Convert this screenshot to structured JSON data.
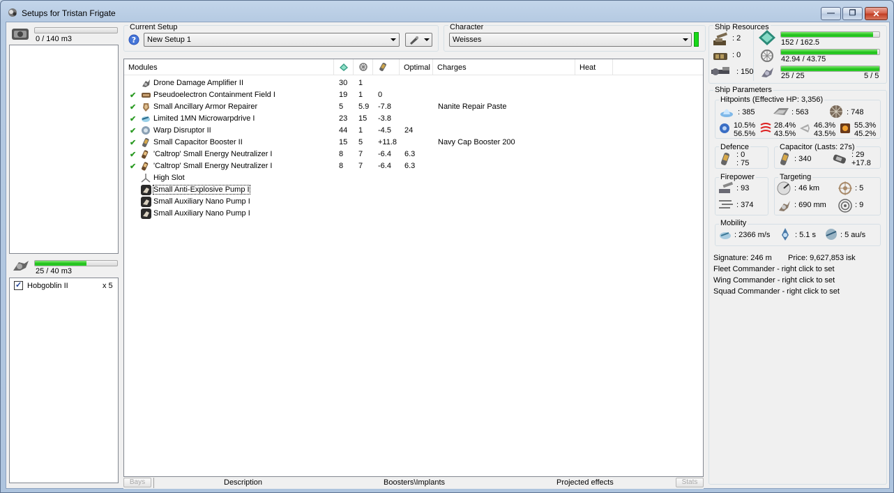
{
  "window": {
    "title": "Setups for Tristan Frigate"
  },
  "cargo": {
    "capacity": "0 / 140 m3",
    "fill": 0
  },
  "drone_bay": {
    "capacity": "25 / 40 m3",
    "fill": 0.625,
    "items": [
      {
        "name": "Hobgoblin II",
        "qty": "x 5",
        "checked": true
      }
    ]
  },
  "setup": {
    "label": "Current Setup",
    "value": "New Setup 1"
  },
  "character": {
    "label": "Character",
    "value": "Weisses"
  },
  "modules": {
    "columns": {
      "name": "Modules",
      "optimal": "Optimal",
      "charges": "Charges",
      "heat": "Heat"
    },
    "rows": [
      {
        "check": "",
        "name": "Drone Damage Amplifier II",
        "c1": "30",
        "c2": "1",
        "c3": "",
        "c4": "",
        "c5": "",
        "icon": "drone-damage-icon"
      },
      {
        "check": "✔",
        "name": "Pseudoelectron Containment Field I",
        "c1": "19",
        "c2": "1",
        "c3": "0",
        "c4": "",
        "c5": "",
        "icon": "containment-field-icon"
      },
      {
        "check": "✔",
        "name": "Small Ancillary Armor Repairer",
        "c1": "5",
        "c2": "5.9",
        "c3": "-7.8",
        "c4": "",
        "c5": "Nanite Repair Paste",
        "icon": "armor-repairer-icon"
      },
      {
        "check": "✔",
        "name": "Limited 1MN Microwarpdrive I",
        "c1": "23",
        "c2": "15",
        "c3": "-3.8",
        "c4": "",
        "c5": "",
        "icon": "microwarpdrive-icon"
      },
      {
        "check": "✔",
        "name": "Warp Disruptor II",
        "c1": "44",
        "c2": "1",
        "c3": "-4.5",
        "c4": "24",
        "c5": "",
        "icon": "warp-disruptor-icon"
      },
      {
        "check": "✔",
        "name": "Small Capacitor Booster II",
        "c1": "15",
        "c2": "5",
        "c3": "+11.8",
        "c4": "",
        "c5": "Navy Cap Booster 200",
        "icon": "capacitor-booster-icon"
      },
      {
        "check": "✔",
        "name": "'Caltrop' Small Energy Neutralizer I",
        "c1": "8",
        "c2": "7",
        "c3": "-6.4",
        "c4": "6.3",
        "c5": "",
        "icon": "energy-neutralizer-icon"
      },
      {
        "check": "✔",
        "name": "'Caltrop' Small Energy Neutralizer I",
        "c1": "8",
        "c2": "7",
        "c3": "-6.4",
        "c4": "6.3",
        "c5": "",
        "icon": "energy-neutralizer-icon"
      },
      {
        "check": "",
        "name": "High Slot",
        "c1": "",
        "c2": "",
        "c3": "",
        "c4": "",
        "c5": "",
        "icon": "high-slot-icon"
      },
      {
        "check": "",
        "name": "Small Anti-Explosive Pump I",
        "c1": "",
        "c2": "",
        "c3": "",
        "c4": "",
        "c5": "",
        "icon": "rig-icon"
      },
      {
        "check": "",
        "name": "Small Auxiliary Nano Pump I",
        "c1": "",
        "c2": "",
        "c3": "",
        "c4": "",
        "c5": "",
        "icon": "rig-icon"
      },
      {
        "check": "",
        "name": "Small Auxiliary Nano Pump I",
        "c1": "",
        "c2": "",
        "c3": "",
        "c4": "",
        "c5": "",
        "icon": "rig-icon"
      }
    ]
  },
  "bottom_tabs": {
    "bays": "Bays",
    "description": "Description",
    "boosters": "Boosters\\Implants",
    "projected": "Projected effects",
    "stats": "Stats"
  },
  "resources": {
    "label": "Ship Resources",
    "turret_hardpoints": ": 2",
    "launcher_hardpoints": ": 0",
    "calibration": ": 150",
    "cpu": "152 / 162.5",
    "cpu_fill": 0.935,
    "powergrid": "42.94 / 43.75",
    "pg_fill": 0.981,
    "drone_bandwidth": "25 / 25",
    "bw_fill": 1.0,
    "drones_active": "5 / 5"
  },
  "params": {
    "label": "Ship Parameters",
    "hitpoints_label": "Hitpoints (Effective HP: 3,356)",
    "shield_hp": ": 385",
    "armor_hp": ": 563",
    "hull_hp": ": 748",
    "em": [
      "10.5%",
      "56.5%"
    ],
    "thermal": [
      "28.4%",
      "43.5%"
    ],
    "kinetic": [
      "46.3%",
      "43.5%"
    ],
    "explosive": [
      "55.3%",
      "45.2%"
    ],
    "defence_label": "Defence",
    "defence": [
      ": 0",
      ": 75"
    ],
    "capacitor_label": "Capacitor (Lasts: 27s)",
    "capacitor_amount": ": 340",
    "capacitor_delta": [
      ": 29",
      "+17.8"
    ],
    "firepower_label": "Firepower",
    "firepower": [
      ": 93",
      ": 374"
    ],
    "targeting_label": "Targeting",
    "targeting_range": ": 46 km",
    "max_targets": ": 5",
    "scan_res": ": 690 mm",
    "sensor_strength": ": 9",
    "mobility_label": "Mobility",
    "speed": ": 2366 m/s",
    "align": ": 5.1 s",
    "warp": ": 5 au/s",
    "signature": "Signature: 246 m",
    "price": "Price: 9,627,853 isk",
    "fleet": "Fleet Commander - right click to set",
    "wing": "Wing Commander - right click to set",
    "squad": "Squad Commander - right click to set"
  }
}
